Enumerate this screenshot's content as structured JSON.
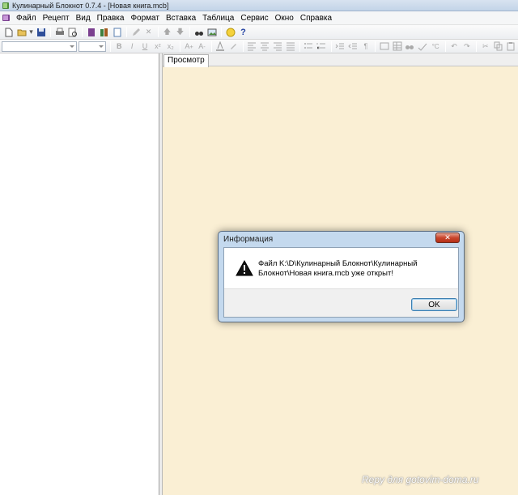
{
  "window": {
    "title": "Кулинарный Блокнот 0.7.4 - [Новая книга.mcb]"
  },
  "menu": {
    "items": [
      "Файл",
      "Рецепт",
      "Вид",
      "Правка",
      "Формат",
      "Вставка",
      "Таблица",
      "Сервис",
      "Окно",
      "Справка"
    ]
  },
  "format_toolbar": {
    "font_name": "",
    "font_size": "",
    "bold": "B",
    "italic": "I",
    "underline": "U",
    "superscript": "x²",
    "subscript": "x₂"
  },
  "tabs": {
    "preview": "Просмотр"
  },
  "dialog": {
    "title": "Информация",
    "close_label": "✕",
    "message": "Файл K:\\D\\Кулинарный Блокнот\\Кулинарный Блокнот\\Новая книга.mcb уже открыт!",
    "ok_label": "OK"
  },
  "watermark": "Repy для gotovim-doma.ru",
  "colors": {
    "preview_bg": "#faefd4",
    "dialog_frame": "#c4d9ee",
    "close_button": "#c9452c"
  }
}
